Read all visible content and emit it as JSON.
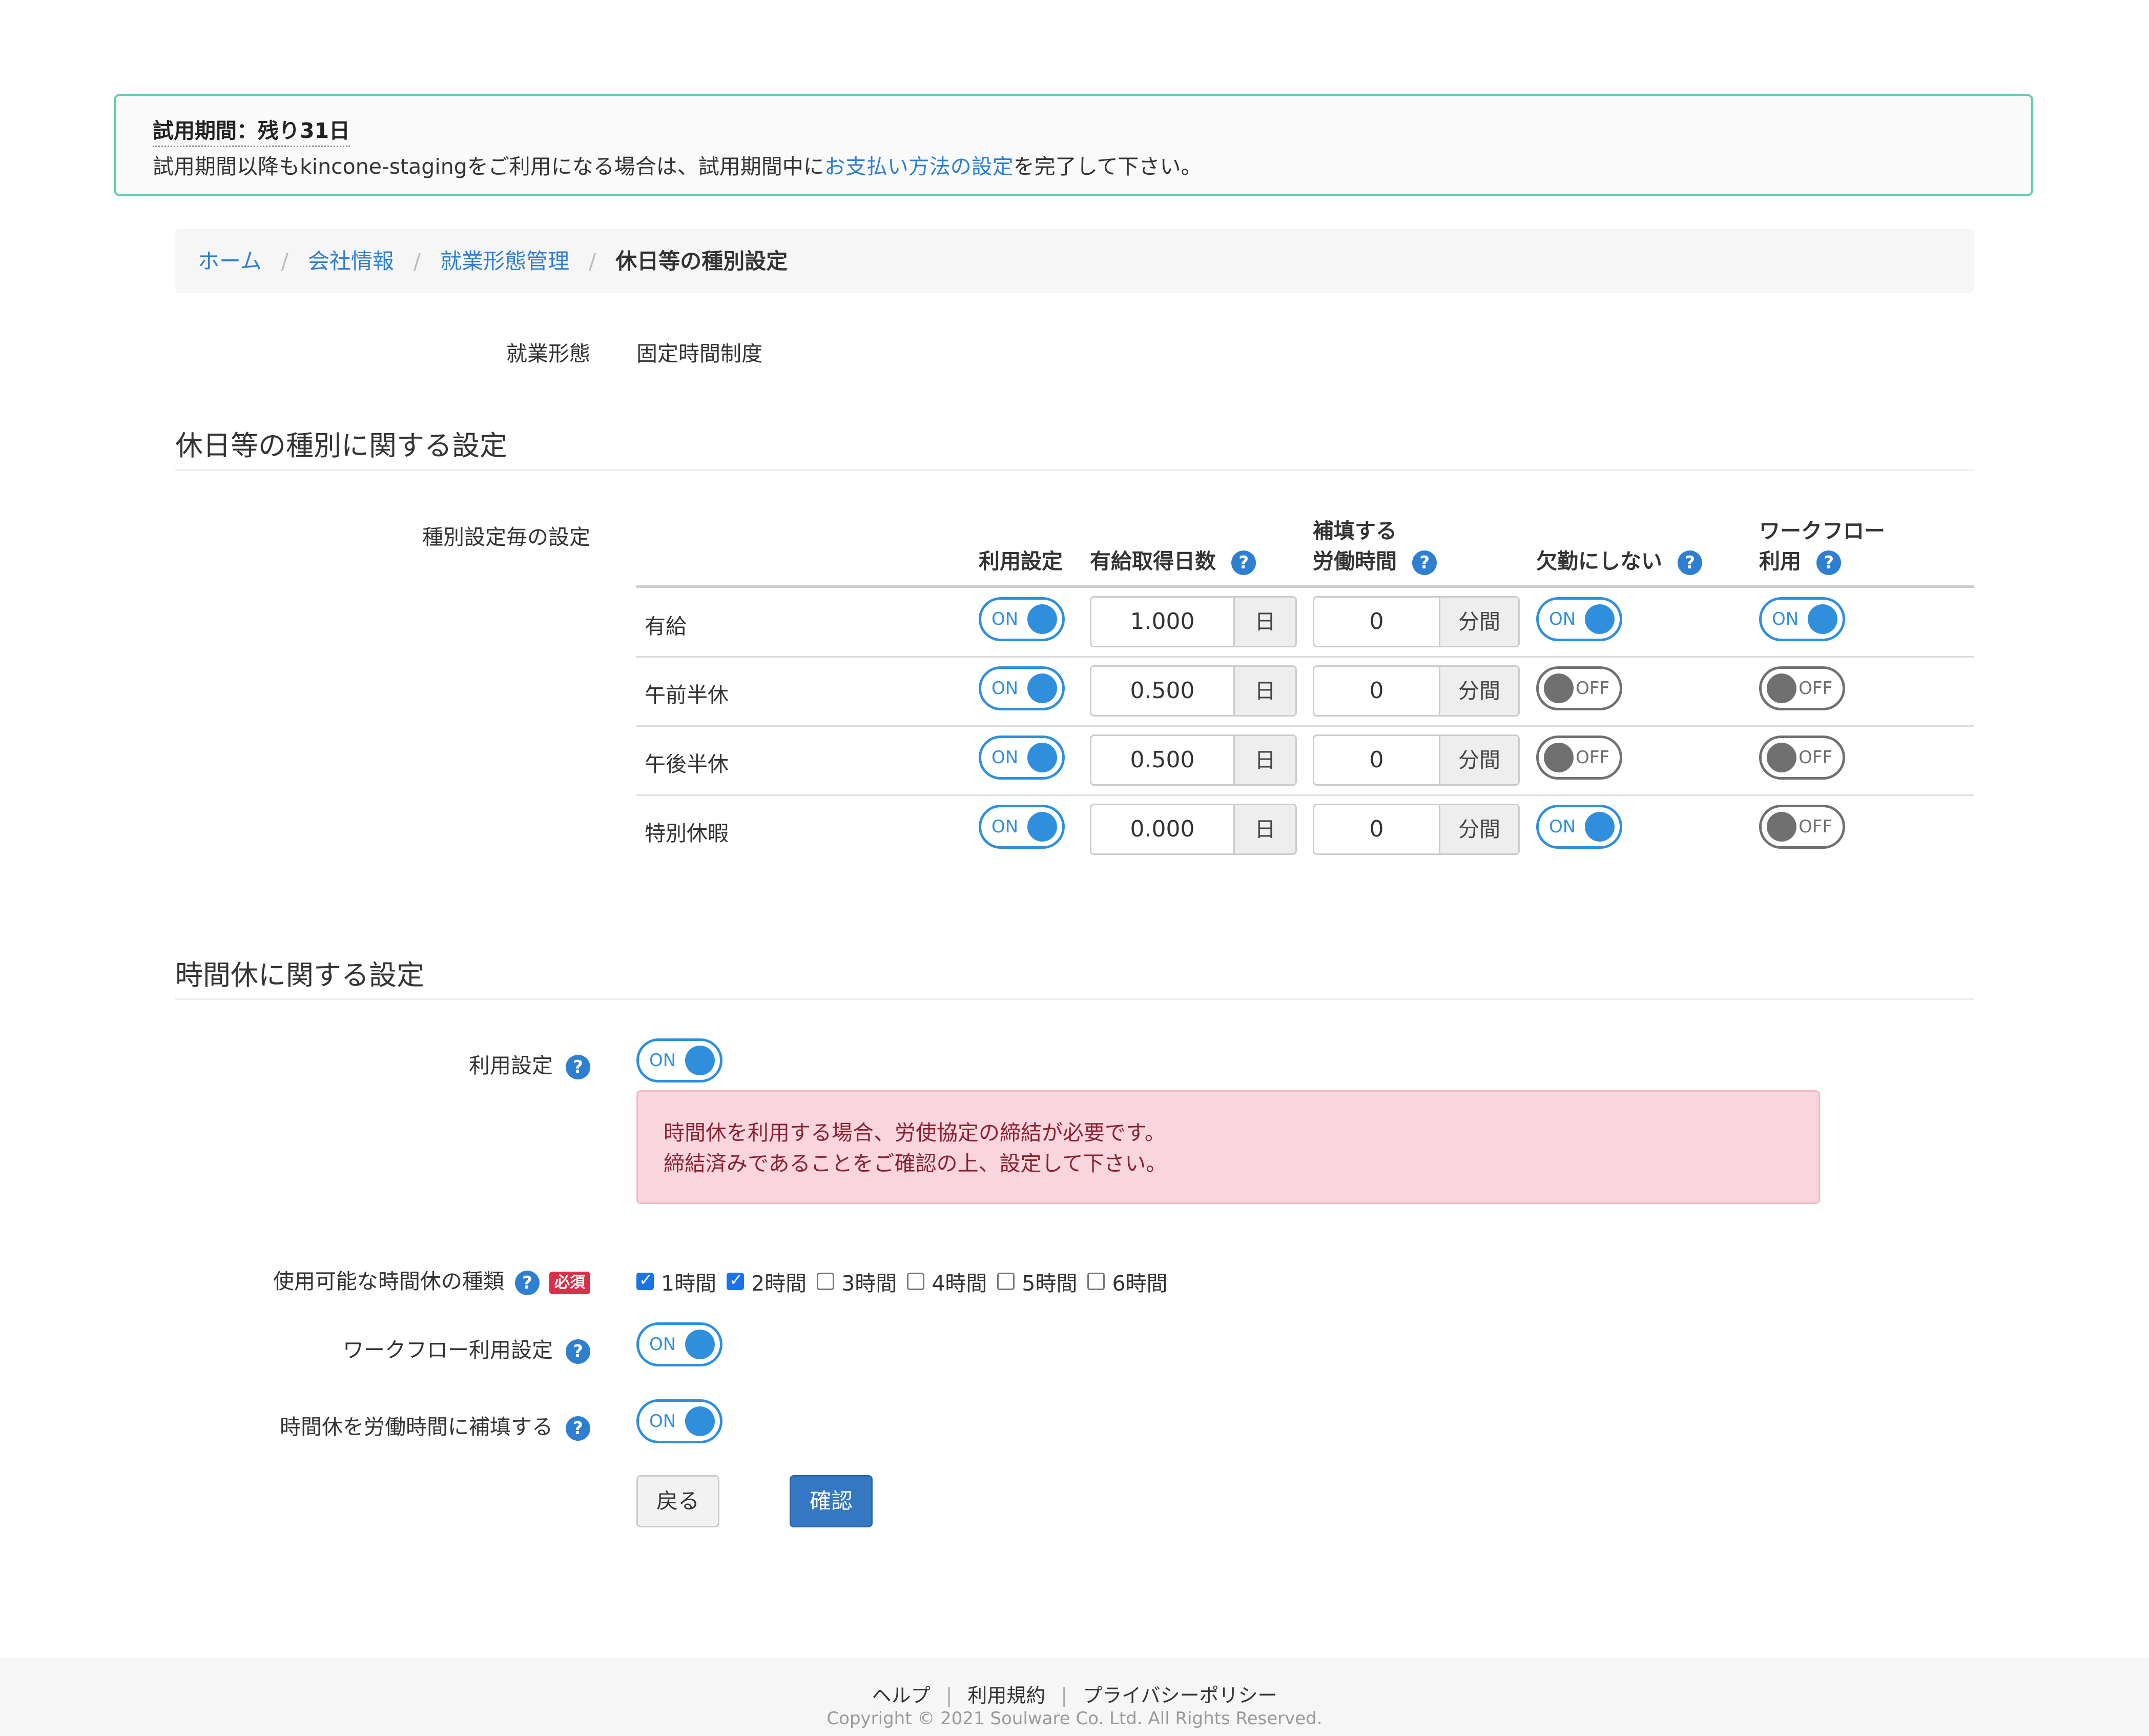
{
  "trial": {
    "title": "試用期間：残り31日",
    "message_before": "試用期間以降もkincone-stagingをご利用になる場合は、試用期間中に",
    "message_link": "お支払い方法の設定",
    "message_after": "を完了して下さい。"
  },
  "breadcrumb": {
    "home": "ホーム",
    "company": "会社情報",
    "work_style": "就業形態管理",
    "current": "休日等の種別設定",
    "separator": "/"
  },
  "work_form": {
    "label": "就業形態",
    "value": "固定時間制度"
  },
  "section1": {
    "title": "休日等の種別に関する設定",
    "subsection_label": "種別設定毎の設定",
    "columns": {
      "use": "利用設定",
      "paid_days": "有給取得日数",
      "comp_line1": "補填する",
      "comp_line2": "労働時間",
      "not_absent": "欠勤にしない",
      "wf_line1": "ワークフロー",
      "wf_line2": "利用"
    },
    "rows": [
      {
        "name": "有給",
        "use": "ON",
        "days": "1.000",
        "days_unit": "日",
        "minutes": "0",
        "minutes_unit": "分間",
        "not_absent": "ON",
        "workflow": "ON"
      },
      {
        "name": "午前半休",
        "use": "ON",
        "days": "0.500",
        "days_unit": "日",
        "minutes": "0",
        "minutes_unit": "分間",
        "not_absent": "OFF",
        "workflow": "OFF"
      },
      {
        "name": "午後半休",
        "use": "ON",
        "days": "0.500",
        "days_unit": "日",
        "minutes": "0",
        "minutes_unit": "分間",
        "not_absent": "OFF",
        "workflow": "OFF"
      },
      {
        "name": "特別休暇",
        "use": "ON",
        "days": "0.000",
        "days_unit": "日",
        "minutes": "0",
        "minutes_unit": "分間",
        "not_absent": "ON",
        "workflow": "OFF"
      }
    ]
  },
  "section2": {
    "title": "時間休に関する設定",
    "use_label": "利用設定",
    "use_value": "ON",
    "alert_line1": "時間休を利用する場合、労使協定の締結が必要です。",
    "alert_line2": "締結済みであることをご確認の上、設定して下さい。",
    "types_label": "使用可能な時間休の種類",
    "required_badge": "必須",
    "types": [
      {
        "label": "1時間",
        "checked": true
      },
      {
        "label": "2時間",
        "checked": true
      },
      {
        "label": "3時間",
        "checked": false
      },
      {
        "label": "4時間",
        "checked": false
      },
      {
        "label": "5時間",
        "checked": false
      },
      {
        "label": "6時間",
        "checked": false
      }
    ],
    "workflow_label": "ワークフロー利用設定",
    "workflow_value": "ON",
    "compensate_label": "時間休を労働時間に補填する",
    "compensate_value": "ON"
  },
  "buttons": {
    "back": "戻る",
    "confirm": "確認"
  },
  "footer": {
    "help": "ヘルプ",
    "terms": "利用規約",
    "privacy": "プライバシーポリシー",
    "separator": "|",
    "copyright": "Copyright © 2021 Soulware Co. Ltd. All Rights Reserved."
  },
  "help_icon": "?",
  "colors": {
    "accent": "#2f8fdd",
    "link": "#2f7fd0",
    "trial_border": "#5fd0b4",
    "alert_bg": "#f9d6dd",
    "required": "#d9304a",
    "primary_button": "#3478c3"
  }
}
